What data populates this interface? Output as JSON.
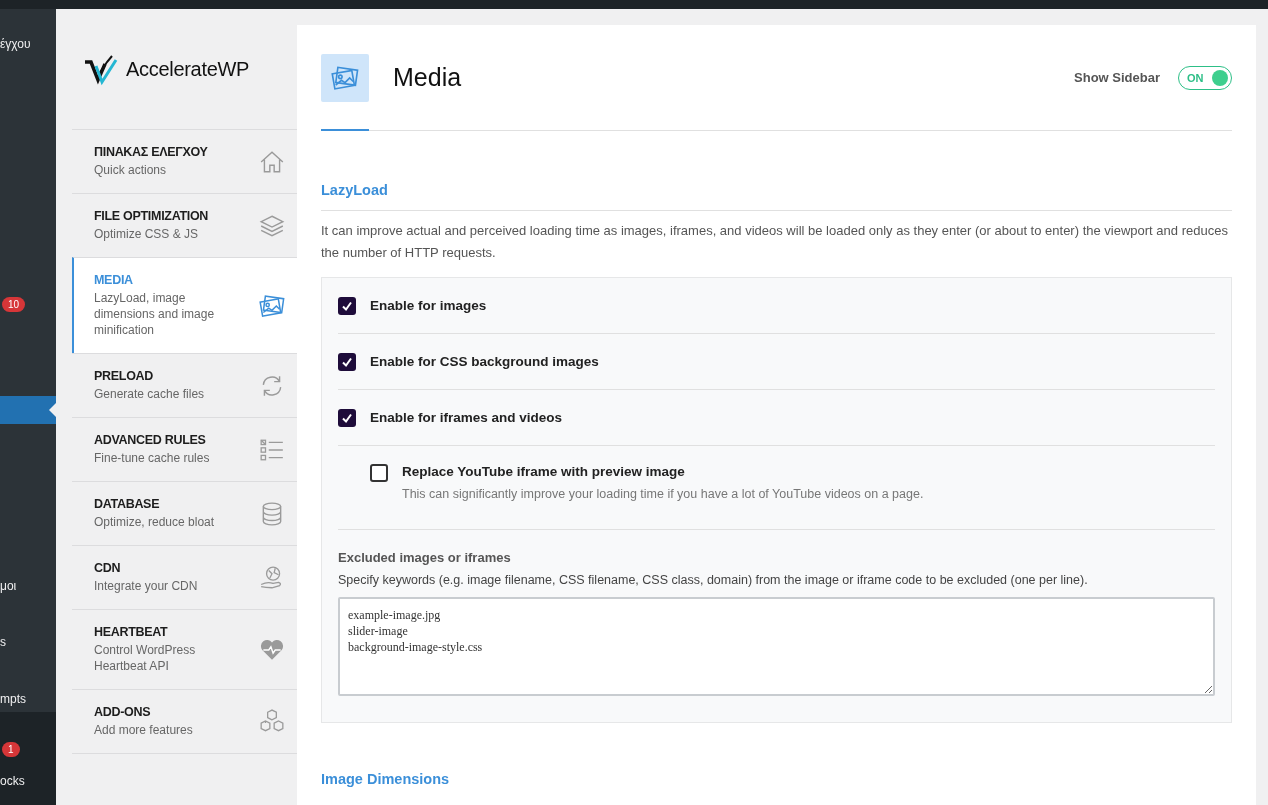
{
  "admin_menu": {
    "items": [
      {
        "label": "έγχου",
        "kind": "text",
        "selected": false
      },
      {
        "label": "10",
        "kind": "badge",
        "selected": false
      },
      {
        "kind": "highlight",
        "selected": true
      },
      {
        "label": "μοι",
        "kind": "text",
        "selected": false
      },
      {
        "label": "s",
        "kind": "text",
        "selected": false
      },
      {
        "label": "mpts",
        "kind": "text",
        "selected": false
      },
      {
        "label": "1",
        "kind": "badge",
        "selected": false
      },
      {
        "label": "ocks",
        "kind": "text",
        "selected": false
      }
    ]
  },
  "plugin_sidebar": {
    "logo": "AccelerateWP",
    "items": [
      {
        "title": "ΠΙΝΑΚΑΣ ΕΛΕΓΧΟΥ",
        "subtitle": "Quick actions",
        "selected": false
      },
      {
        "title": "FILE OPTIMIZATION",
        "subtitle": "Optimize CSS & JS",
        "selected": false
      },
      {
        "title": "MEDIA",
        "subtitle": "LazyLoad, image dimensions and image minification",
        "selected": true
      },
      {
        "title": "PRELOAD",
        "subtitle": "Generate cache files",
        "selected": false
      },
      {
        "title": "ADVANCED RULES",
        "subtitle": "Fine-tune cache rules",
        "selected": false
      },
      {
        "title": "DATABASE",
        "subtitle": "Optimize, reduce bloat",
        "selected": false
      },
      {
        "title": "CDN",
        "subtitle": "Integrate your CDN",
        "selected": false
      },
      {
        "title": "HEARTBEAT",
        "subtitle": "Control WordPress Heartbeat API",
        "selected": false
      },
      {
        "title": "ADD-ONS",
        "subtitle": "Add more features",
        "selected": false
      }
    ]
  },
  "header": {
    "title": "Media",
    "show_sidebar_label": "Show Sidebar",
    "toggle": {
      "label": "ON",
      "on": true
    }
  },
  "lazyload": {
    "title": "LazyLoad",
    "description": "It can improve actual and perceived loading time as images, iframes, and videos will be loaded only as they enter (or about to enter) the viewport and reduces the number of HTTP requests.",
    "options": [
      {
        "label": "Enable for images",
        "checked": true
      },
      {
        "label": "Enable for CSS background images",
        "checked": true
      },
      {
        "label": "Enable for iframes and videos",
        "checked": true,
        "children": [
          {
            "label": "Replace YouTube iframe with preview image",
            "checked": false,
            "description": "This can significantly improve your loading time if you have a lot of YouTube videos on a page."
          }
        ]
      }
    ],
    "excluded": {
      "label": "Excluded images or iframes",
      "description": "Specify keywords (e.g. image filename, CSS filename, CSS class, domain) from the image or iframe code to be excluded (one per line).",
      "value": "example-image.jpg\nslider-image\nbackground-image-style.css"
    }
  },
  "next_section": {
    "title": "Image Dimensions"
  }
}
